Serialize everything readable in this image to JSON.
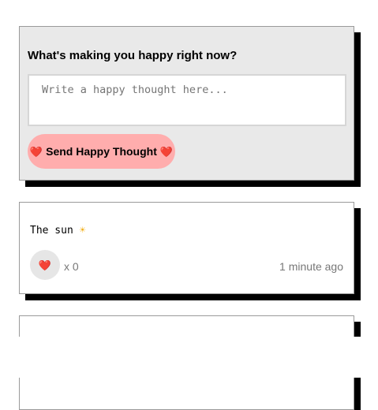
{
  "form": {
    "prompt": "What's making you happy right now?",
    "placeholder": "Write a happy thought here...",
    "button_label": "Send Happy Thought"
  },
  "icons": {
    "heart": "heart-icon",
    "sun": "sun-icon"
  },
  "colors": {
    "button_bg": "#ffadad",
    "form_bg": "#e9e9e9",
    "like_bg": "#e6e6e6",
    "heart": "#e0162b"
  },
  "thoughts": [
    {
      "text": "The sun",
      "emoji": "sun",
      "likes": "x 0",
      "time": "1 minute ago"
    }
  ]
}
